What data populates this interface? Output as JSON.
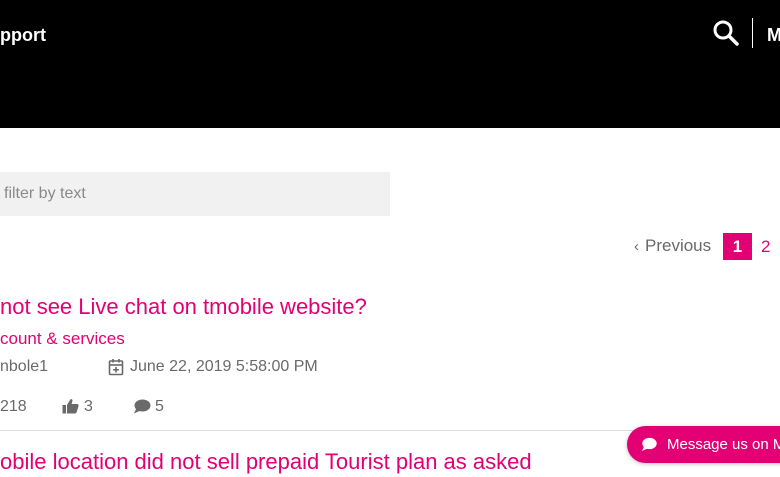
{
  "header": {
    "title": "pport",
    "menu_label": "M"
  },
  "filter": {
    "placeholder": "filter by text"
  },
  "pagination": {
    "previous_label": "Previous",
    "current_page": "1",
    "next_page": "2"
  },
  "posts": [
    {
      "title": "not see Live chat on tmobile website?",
      "category": "count & services",
      "author": "nbole1",
      "date": "June 22, 2019 5:58:00 PM",
      "views": "218",
      "likes": "3",
      "replies": "5"
    },
    {
      "title": "obile location did not sell prepaid Tourist plan as asked"
    }
  ],
  "chat_button": {
    "label": "Message us on M"
  },
  "colors": {
    "brand": "#e20074",
    "header_bg": "#000000",
    "muted_text": "#6a6a6a"
  }
}
